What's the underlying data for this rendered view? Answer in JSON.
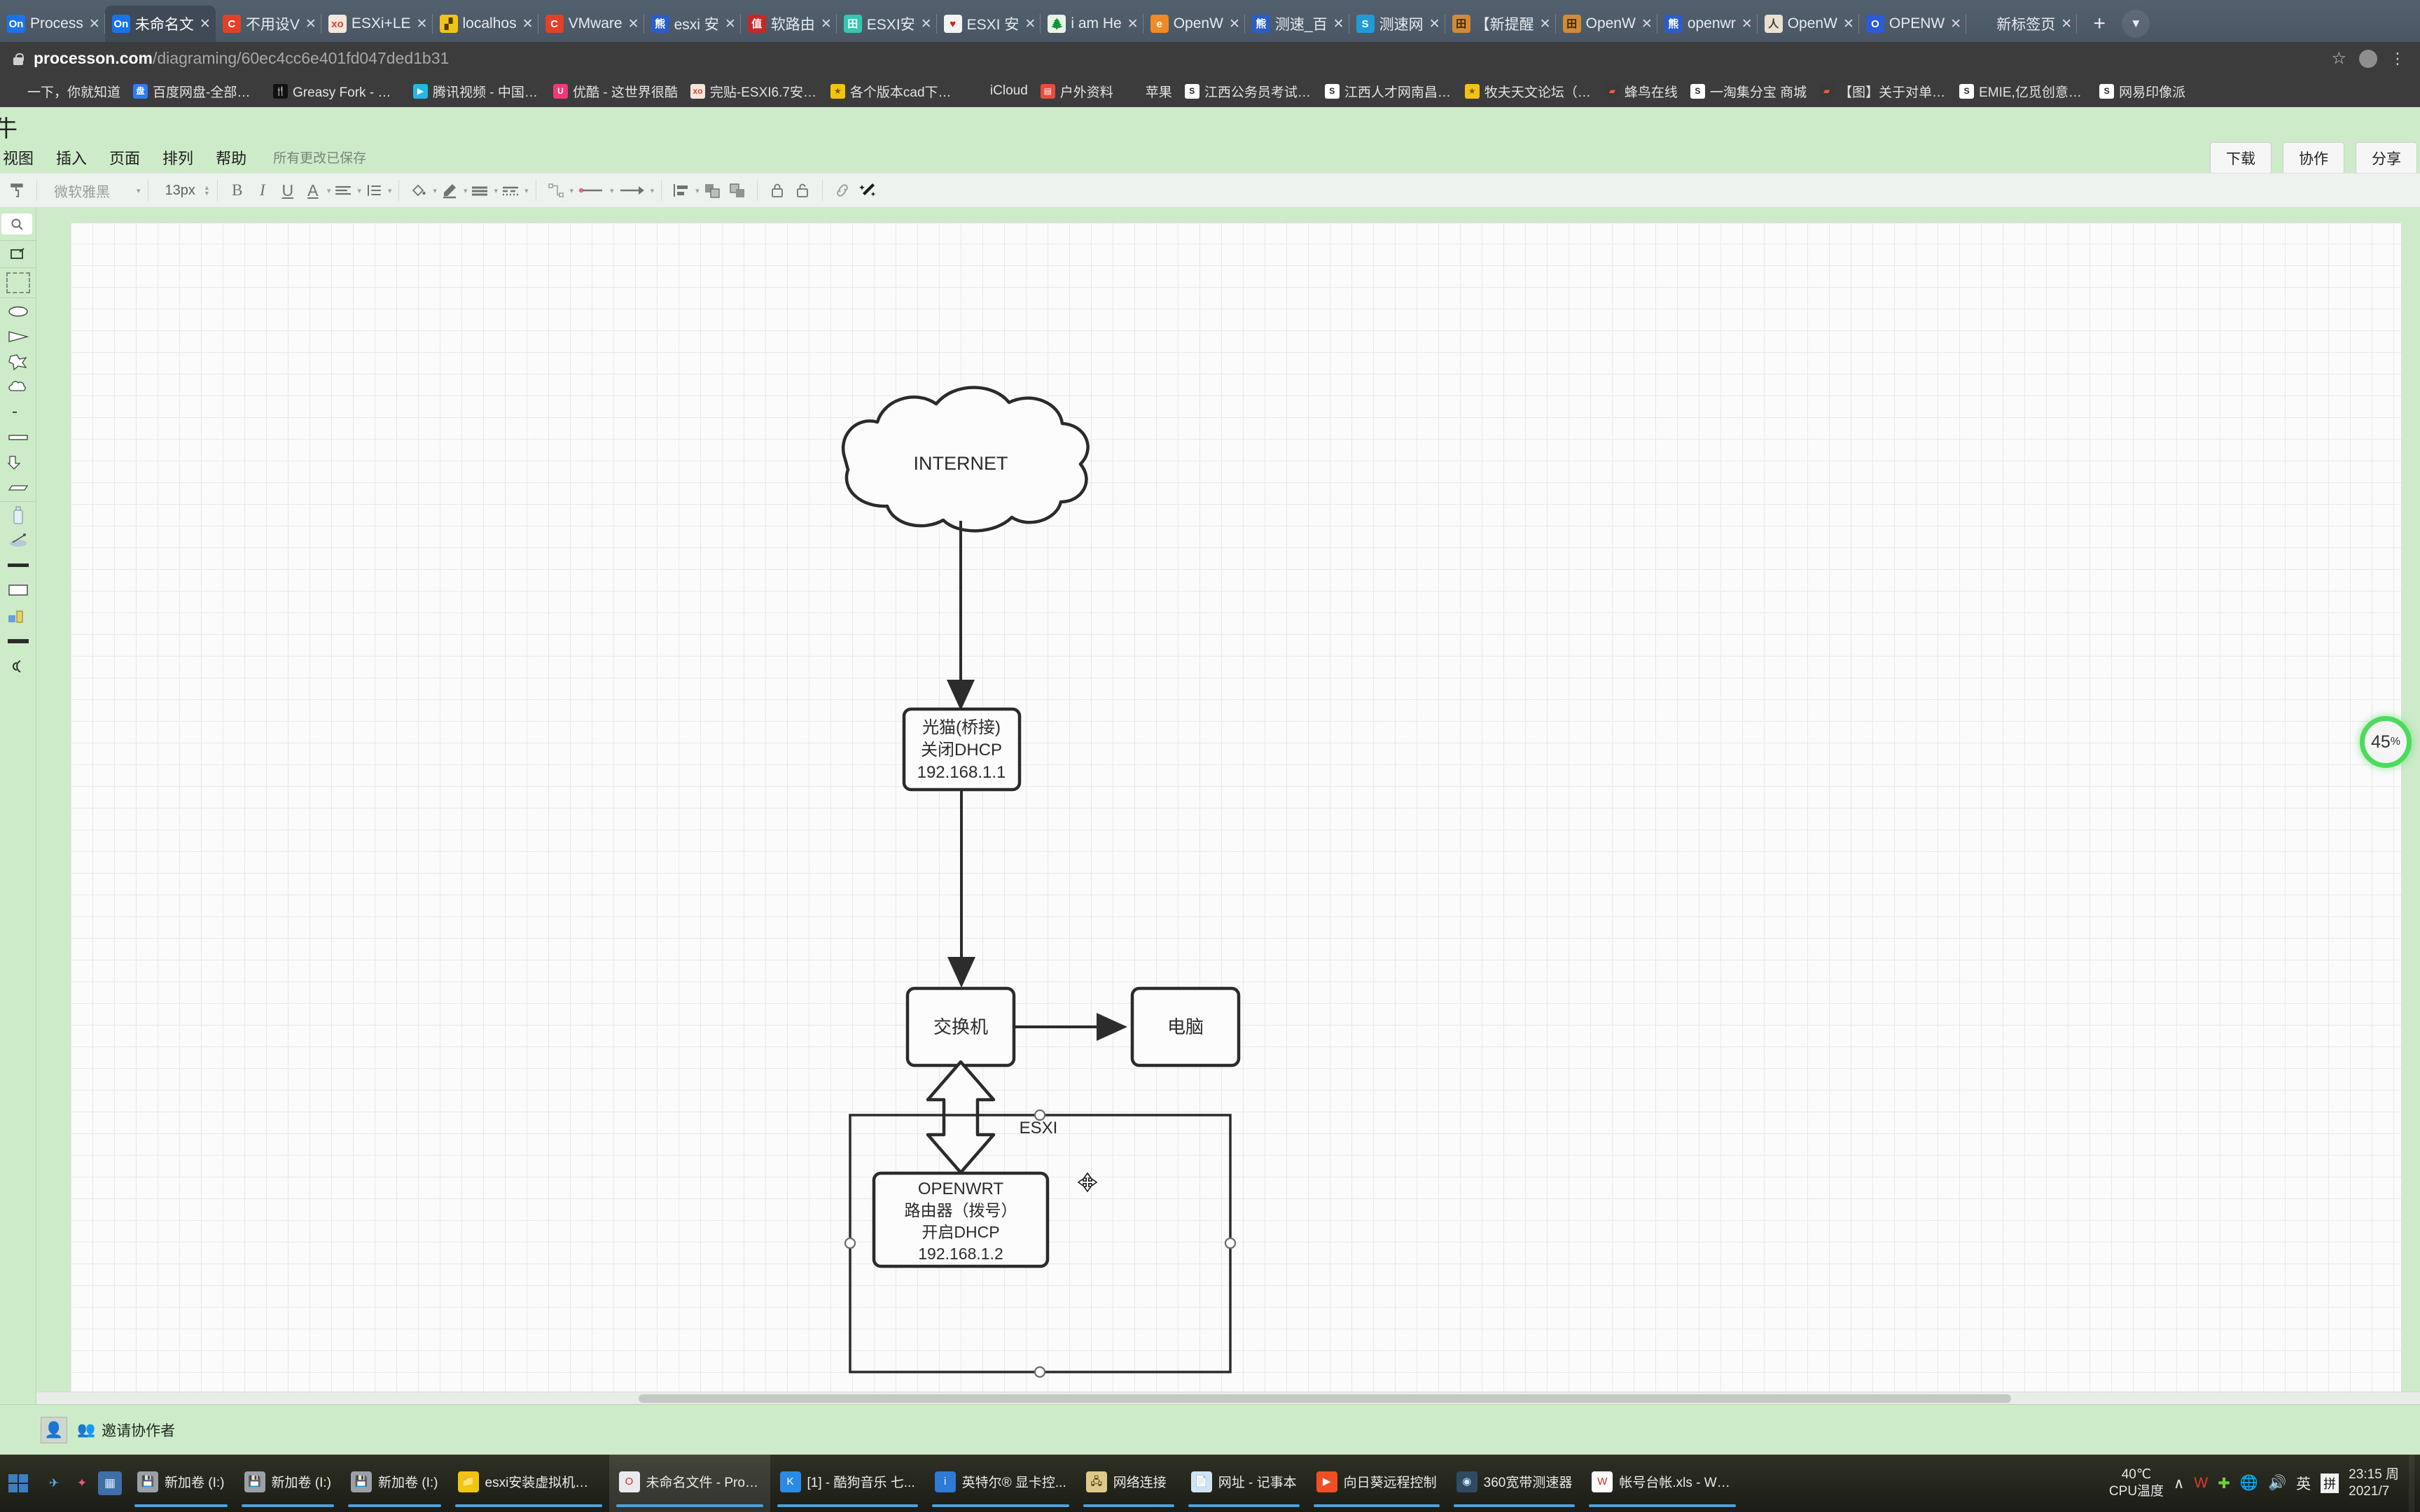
{
  "browser": {
    "tabs": [
      {
        "title": "Process",
        "favicon": "On",
        "fav_bg": "#1a73e8",
        "fav_color": "#ffffff",
        "active": false
      },
      {
        "title": "未命名文",
        "favicon": "On",
        "fav_bg": "#1a73e8",
        "fav_color": "#ffffff",
        "active": true
      },
      {
        "title": "不用设V",
        "favicon": "C",
        "fav_bg": "#e2402a",
        "fav_color": "#ffffff",
        "active": false
      },
      {
        "title": "ESXi+LE",
        "favicon": "xo",
        "fav_bg": "#f4e6dd",
        "fav_color": "#d04a2a",
        "active": false
      },
      {
        "title": "localhos",
        "favicon": "▞",
        "fav_bg": "#f0c419",
        "fav_color": "#4a3a00",
        "active": false
      },
      {
        "title": "VMware",
        "favicon": "C",
        "fav_bg": "#e2402a",
        "fav_color": "#ffffff",
        "active": false
      },
      {
        "title": "esxi 安",
        "favicon": "熊",
        "fav_bg": "#2b5ec4",
        "fav_color": "#ffffff",
        "active": false
      },
      {
        "title": "软路由",
        "favicon": "值",
        "fav_bg": "#c62828",
        "fav_color": "#ffffff",
        "active": false
      },
      {
        "title": "ESXI安",
        "favicon": "田",
        "fav_bg": "#35c6b0",
        "fav_color": "#ffffff",
        "active": false
      },
      {
        "title": "ESXI 安",
        "favicon": "♥",
        "fav_bg": "#f3f3f3",
        "fav_color": "#d32020",
        "active": false
      },
      {
        "title": "i am He",
        "favicon": "🌲",
        "fav_bg": "#e7f3e4",
        "fav_color": "#2e7d32",
        "active": false
      },
      {
        "title": "OpenW",
        "favicon": "e",
        "fav_bg": "#f08a24",
        "fav_color": "#ffffff",
        "active": false
      },
      {
        "title": "测速_百",
        "favicon": "熊",
        "fav_bg": "#2b5ec4",
        "fav_color": "#ffffff",
        "active": false
      },
      {
        "title": "测速网",
        "favicon": "S",
        "fav_bg": "#1f9bd8",
        "fav_color": "#ffffff",
        "active": false
      },
      {
        "title": "【新提醒",
        "favicon": "田",
        "fav_bg": "#cf8a3a",
        "fav_color": "#3a2400",
        "active": false
      },
      {
        "title": "OpenW",
        "favicon": "田",
        "fav_bg": "#cf8a3a",
        "fav_color": "#3a2400",
        "active": false
      },
      {
        "title": "openwr",
        "favicon": "熊",
        "fav_bg": "#2b5ec4",
        "fav_color": "#ffffff",
        "active": false
      },
      {
        "title": "OpenW",
        "favicon": "人",
        "fav_bg": "#e8e0d0",
        "fav_color": "#4a3a20",
        "active": false
      },
      {
        "title": "OPENW",
        "favicon": "O",
        "fav_bg": "#2d5bd7",
        "fav_color": "#ffffff",
        "active": false
      },
      {
        "title": "新标签页",
        "favicon": "",
        "fav_bg": "transparent",
        "fav_color": "#ffffff",
        "active": false
      }
    ],
    "new_tab_label": "+",
    "tab_list_label": "▼",
    "address": {
      "host": "processon.com",
      "path": "/diagraming/60ec4cc6e401fd047ded1b31",
      "full_url": "processon.com/diagraming/60ec4cc6e401fd047ded1b31",
      "star": "☆",
      "menu": "⋮"
    },
    "bookmarks": [
      {
        "label": "一下，你就知道",
        "ico": "",
        "bg": "transparent",
        "fg": "#ffffff"
      },
      {
        "label": "百度网盘-全部文件",
        "ico": "盘",
        "bg": "#2d7bf5",
        "fg": "#ffffff"
      },
      {
        "label": "Greasy Fork - 安全...",
        "ico": "🍴",
        "bg": "#111111",
        "fg": "#ffffff"
      },
      {
        "label": "腾讯视频 - 中国领...",
        "ico": "▶",
        "bg": "#23b7e5",
        "fg": "#ffffff"
      },
      {
        "label": "优酷 - 这世界很酷",
        "ico": "U",
        "bg": "#f7367a",
        "fg": "#ffffff"
      },
      {
        "label": "完贴-ESXI6.7安装...",
        "ico": "xo",
        "bg": "#f4e6dd",
        "fg": "#d04a2a"
      },
      {
        "label": "各个版本cad下载(...",
        "ico": "★",
        "bg": "#f1c40f",
        "fg": "#7a5a00"
      },
      {
        "label": "iCloud",
        "ico": "",
        "bg": "transparent",
        "fg": "#cccccc"
      },
      {
        "label": "户外资料",
        "ico": "▤",
        "bg": "#e74c3c",
        "fg": "#ffffff"
      },
      {
        "label": "苹果",
        "ico": "",
        "bg": "transparent",
        "fg": "#cccccc"
      },
      {
        "label": "江西公务员考试网-...",
        "ico": "S",
        "bg": "#ffffff",
        "fg": "#222222"
      },
      {
        "label": "江西人才网南昌人...",
        "ico": "S",
        "bg": "#ffffff",
        "fg": "#222222"
      },
      {
        "label": "牧夫天文论坛（中...",
        "ico": "★",
        "bg": "#f1c40f",
        "fg": "#7a5a00"
      },
      {
        "label": "蜂鸟在线",
        "ico": "▰",
        "bg": "#3a3a3a",
        "fg": "#ff5a3c"
      },
      {
        "label": "一淘集分宝 商城",
        "ico": "S",
        "bg": "#ffffff",
        "fg": "#222222"
      },
      {
        "label": "【图】关于对单反...",
        "ico": "▰",
        "bg": "#3a3a3a",
        "fg": "#ff5a3c"
      },
      {
        "label": "EMIE,亿觅创意网 |...",
        "ico": "S",
        "bg": "#ffffff",
        "fg": "#222222"
      },
      {
        "label": "网易印像派",
        "ico": "S",
        "bg": "#ffffff",
        "fg": "#222222"
      }
    ]
  },
  "app": {
    "doc_title_fragment": "牛",
    "menus": [
      "视图",
      "插入",
      "页面",
      "排列",
      "帮助"
    ],
    "save_status": "所有更改已保存",
    "actions": [
      {
        "label": "下载"
      },
      {
        "label": "协作"
      },
      {
        "label": "分享"
      }
    ],
    "toolbar": {
      "format_painter": "format-painter",
      "font_family": "微软雅黑",
      "font_size": "13px",
      "bold": "B",
      "italic": "I",
      "underline": "U",
      "font_color": "A",
      "align": "≡",
      "line_spacing": "↕",
      "fill_color": "fill",
      "line_color": "pen",
      "line_style_solid": "solid",
      "line_style_dashed": "dashed",
      "connector": "connector",
      "line_start": "line-start",
      "line_end": "arrow-end",
      "align_objects": "align",
      "bring_front": "front",
      "send_back": "back",
      "lock": "lock",
      "unlock": "unlock",
      "link": "link",
      "magic": "magic"
    },
    "zoom_level": "45",
    "zoom_unit": "%",
    "footer": {
      "invite_label": "邀请协作者"
    }
  },
  "diagram": {
    "nodes": [
      {
        "id": "internet",
        "shape": "cloud",
        "label": "INTERNET"
      },
      {
        "id": "modem",
        "shape": "rounded-rect",
        "lines": [
          "光猫(桥接)",
          "关闭DHCP",
          "192.168.1.1"
        ]
      },
      {
        "id": "switch",
        "shape": "rounded-rect",
        "lines": [
          "交换机"
        ]
      },
      {
        "id": "pc",
        "shape": "rounded-rect",
        "lines": [
          "电脑"
        ]
      },
      {
        "id": "esxi",
        "shape": "rect-container",
        "label": "ESXI",
        "selected": true
      },
      {
        "id": "openwrt",
        "shape": "rounded-rect",
        "lines": [
          "OPENWRT",
          "路由器（拨号）",
          "开启DHCP",
          "192.168.1.2"
        ]
      }
    ],
    "edges": [
      {
        "from": "internet",
        "to": "modem",
        "style": "arrow-down"
      },
      {
        "from": "modem",
        "to": "switch",
        "style": "arrow-down"
      },
      {
        "from": "switch",
        "to": "pc",
        "style": "arrow-right"
      },
      {
        "from": "switch",
        "to": "openwrt",
        "style": "double-block-arrow"
      }
    ],
    "cursor": "move-cursor"
  },
  "taskbar": {
    "quick_launch": [
      {
        "name": "app-blue",
        "glyph": "✈",
        "bg": "transparent",
        "fg": "#5ab0f0"
      },
      {
        "name": "app-butterfly",
        "glyph": "✦",
        "bg": "transparent",
        "fg": "#ff5577"
      },
      {
        "name": "app-calculator",
        "glyph": "▦",
        "bg": "#3f6fa8",
        "fg": "#dce9f7"
      }
    ],
    "tasks": [
      {
        "label": "新加卷 (I:)",
        "ico": "💾",
        "bg": "#9aa0a6",
        "fg": "#ffffff",
        "active": false,
        "open": true
      },
      {
        "label": "新加卷 (I:)",
        "ico": "💾",
        "bg": "#9aa0a6",
        "fg": "#ffffff",
        "active": false,
        "open": true
      },
      {
        "label": "新加卷 (I:)",
        "ico": "💾",
        "bg": "#9aa0a6",
        "fg": "#ffffff",
        "active": false,
        "open": true
      },
      {
        "label": "esxi安装虚拟机工...",
        "ico": "📁",
        "bg": "#f1c40f",
        "fg": "#6b4e00",
        "active": false,
        "open": true
      },
      {
        "label": "未命名文件 - Proc...",
        "ico": "O",
        "bg": "#e8eaed",
        "fg": "#d93025",
        "active": true,
        "open": true
      },
      {
        "label": "[1] - 酷狗音乐 七...",
        "ico": "K",
        "bg": "#2b8ae2",
        "fg": "#ffffff",
        "active": false,
        "open": true
      },
      {
        "label": "英特尔® 显卡控...",
        "ico": "i",
        "bg": "#2d7bd6",
        "fg": "#ffffff",
        "active": false,
        "open": true
      },
      {
        "label": "网络连接",
        "ico": "🖧",
        "bg": "#dfc98a",
        "fg": "#3a3000",
        "active": false,
        "open": true
      },
      {
        "label": "网址 - 记事本",
        "ico": "📄",
        "bg": "#cfe3f2",
        "fg": "#2a4a66",
        "active": false,
        "open": true
      },
      {
        "label": "向日葵远程控制",
        "ico": "▶",
        "bg": "#f04e23",
        "fg": "#ffffff",
        "active": false,
        "open": true
      },
      {
        "label": "360宽带测速器",
        "ico": "◉",
        "bg": "#2f4a63",
        "fg": "#cfe8ff",
        "active": false,
        "open": true
      },
      {
        "label": "帐号台帐.xls - WP...",
        "ico": "W",
        "bg": "#ffffff",
        "fg": "#d42b1f",
        "active": false,
        "open": true
      }
    ],
    "tray": {
      "temperature": "40℃",
      "temperature_label": "CPU温度",
      "overflow": "∧",
      "icons": [
        "W",
        "✚",
        "🌐",
        "🔊"
      ],
      "ime_lang": "英",
      "ime_mode": "拼",
      "clock_time": "23:15 周",
      "clock_date": "2021/7"
    }
  }
}
